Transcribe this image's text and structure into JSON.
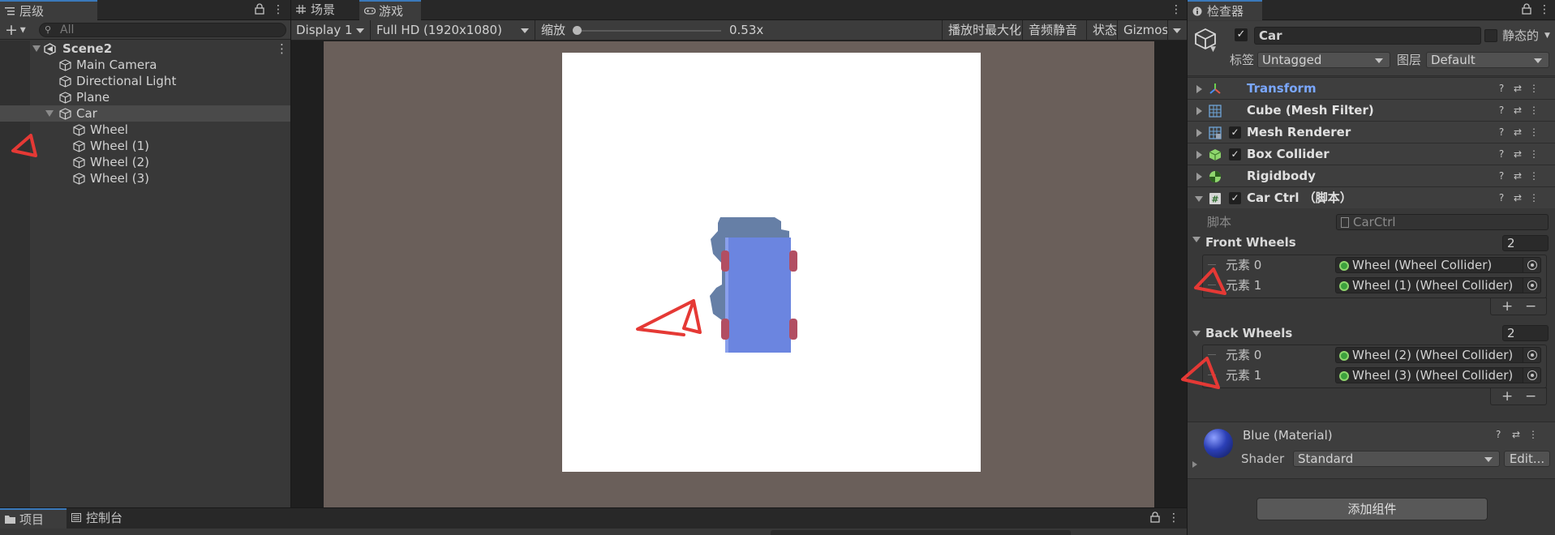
{
  "hierarchy": {
    "tab_label": "层级",
    "add_label": "+",
    "search_placeholder": "All",
    "scene_name": "Scene2",
    "items": [
      {
        "label": "Main Camera"
      },
      {
        "label": "Directional Light"
      },
      {
        "label": "Plane"
      },
      {
        "label": "Car"
      },
      {
        "label": "Wheel"
      },
      {
        "label": "Wheel (1)"
      },
      {
        "label": "Wheel (2)"
      },
      {
        "label": "Wheel (3)"
      }
    ]
  },
  "game_view": {
    "tabs": [
      {
        "label": "场景"
      },
      {
        "label": "游戏"
      }
    ],
    "display": "Display 1",
    "resolution": "Full HD (1920x1080)",
    "scale_label": "缩放",
    "scale_value": "0.53x",
    "scale_fraction": 0.0,
    "toggles": [
      "播放时最大化",
      "音频静音",
      "状态",
      "Gizmos"
    ]
  },
  "inspector": {
    "tab_label": "检查器",
    "object_name": "Car",
    "static_label": "静态的",
    "tag_label": "标签",
    "tag_value": "Untagged",
    "layer_label": "图层",
    "layer_value": "Default",
    "components": [
      {
        "name": "Transform",
        "has_checkbox": false,
        "icon": "transform-icon"
      },
      {
        "name": "Cube (Mesh Filter)",
        "has_checkbox": false,
        "icon": "mesh-filter-icon"
      },
      {
        "name": "Mesh Renderer",
        "has_checkbox": true,
        "icon": "mesh-renderer-icon"
      },
      {
        "name": "Box Collider",
        "has_checkbox": true,
        "icon": "box-collider-icon"
      },
      {
        "name": "Rigidbody",
        "has_checkbox": false,
        "icon": "rigidbody-icon"
      },
      {
        "name": "Car Ctrl  （脚本）",
        "has_checkbox": true,
        "icon": "script-icon"
      }
    ],
    "script_label": "脚本",
    "script_value": "CarCtrl",
    "front_wheels": {
      "label": "Front Wheels",
      "count": "2",
      "elements": [
        {
          "label": "元素 0",
          "value": "Wheel (Wheel Collider)"
        },
        {
          "label": "元素 1",
          "value": "Wheel (1) (Wheel Collider)"
        }
      ]
    },
    "back_wheels": {
      "label": "Back Wheels",
      "count": "2",
      "elements": [
        {
          "label": "元素 0",
          "value": "Wheel (2) (Wheel Collider)"
        },
        {
          "label": "元素 1",
          "value": "Wheel (3) (Wheel Collider)"
        }
      ]
    },
    "plus_label": "+",
    "minus_label": "−",
    "material_name": "Blue (Material)",
    "shader_label": "Shader",
    "shader_value": "Standard",
    "edit_label": "Edit...",
    "add_component_label": "添加组件"
  },
  "bottom": {
    "tabs": [
      {
        "label": "项目"
      },
      {
        "label": "控制台"
      }
    ]
  },
  "colors": {
    "panel_bg": "#383838",
    "viewport_bg": "#6a5f5a",
    "car_body": "#6b85e0",
    "annotation_red": "#e53935",
    "transform_label": "#7aa7ff"
  }
}
